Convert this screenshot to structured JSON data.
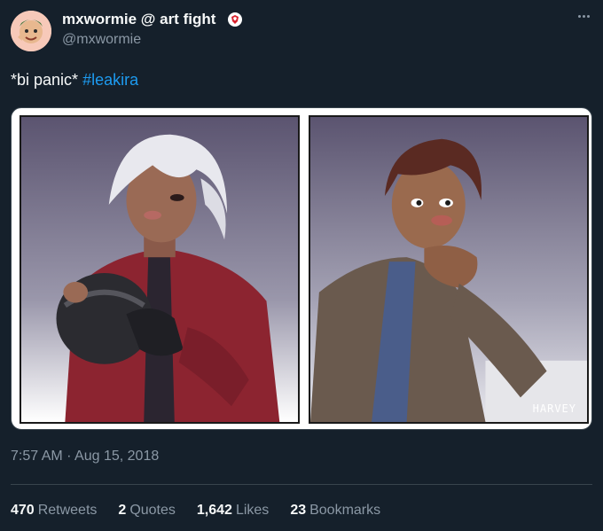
{
  "tweet": {
    "display_name": "mxwormie @ art fight",
    "handle": "@mxwormie",
    "text_prefix": "*bi panic* ",
    "hashtag": "#leakira",
    "time": "7:57 AM",
    "separator": " · ",
    "date": "Aug 15, 2018",
    "signature": "HARVEY"
  },
  "stats": {
    "retweets_count": "470",
    "retweets_label": "Retweets",
    "quotes_count": "2",
    "quotes_label": "Quotes",
    "likes_count": "1,642",
    "likes_label": "Likes",
    "bookmarks_count": "23",
    "bookmarks_label": "Bookmarks"
  },
  "colors": {
    "background": "#15202b",
    "text": "#f7f9f9",
    "muted": "#8b98a5",
    "link": "#1d9bf0"
  },
  "icons": {
    "badge": "art-fight-badge-icon",
    "more": "more-options-icon"
  }
}
